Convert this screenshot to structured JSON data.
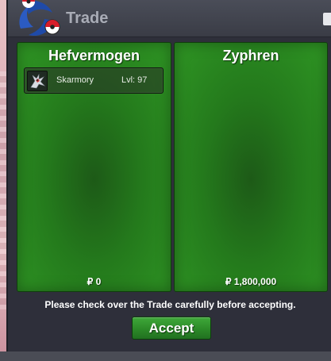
{
  "window": {
    "title": "Trade",
    "logo_icon": "pokeball-swirl-icon"
  },
  "trade": {
    "left": {
      "player": "Hefvermogen",
      "items": [
        {
          "sprite_icon": "skarmory-sprite-icon",
          "name": "Skarmory",
          "level": "Lvl: 97"
        }
      ],
      "money": "₽ 0"
    },
    "right": {
      "player": "Zyphren",
      "items": [],
      "money": "₽ 1,800,000"
    }
  },
  "notice": "Please check over the Trade carefully before accepting.",
  "accept_label": "Accept",
  "colors": {
    "panel_green": "#247a1c",
    "button_green": "#2c8a28",
    "window_bg": "#2e2f3a",
    "title_text": "#a9acb6"
  }
}
